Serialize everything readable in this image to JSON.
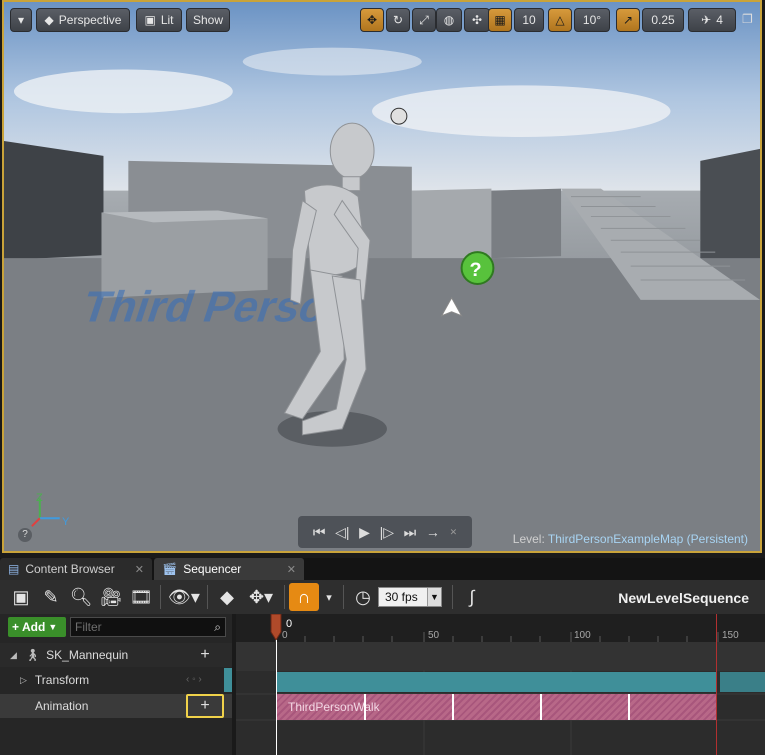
{
  "viewport": {
    "toolbar": {
      "dropdown_arrow": "▾",
      "perspective_label": "Perspective",
      "lit_label": "Lit",
      "show_label": "Show",
      "grid_snap_value": "10",
      "rotation_snap_value": "10°",
      "scale_snap_value": "0.25",
      "camera_speed_value": "4"
    },
    "level_prefix": "Level:",
    "level_name": "ThirdPersonExampleMap (Persistent)",
    "axis": {
      "z": "Z",
      "y": "Y"
    },
    "scene_text": "Third Person"
  },
  "tabs": [
    {
      "label": "Content Browser",
      "active": false
    },
    {
      "label": "Sequencer",
      "active": true
    }
  ],
  "sequencer": {
    "fps_value": "30 fps",
    "sequence_name": "NewLevelSequence",
    "add_label": "Add",
    "filter_placeholder": "Filter",
    "tracks": [
      {
        "label": "SK_Mannequin"
      },
      {
        "label": "Transform"
      },
      {
        "label": "Animation"
      }
    ],
    "timeline": {
      "playhead_value": "0",
      "ticks": [
        "0",
        "50",
        "100",
        "150"
      ],
      "animation_section_label": "ThirdPersonWalk"
    }
  },
  "colors": {
    "viewport_border": "#c9a33a",
    "transform_section": "#3f8f99",
    "animation_section": "#b86888",
    "magnet_active": "#e68a13",
    "add_button": "#3a8f2a"
  }
}
